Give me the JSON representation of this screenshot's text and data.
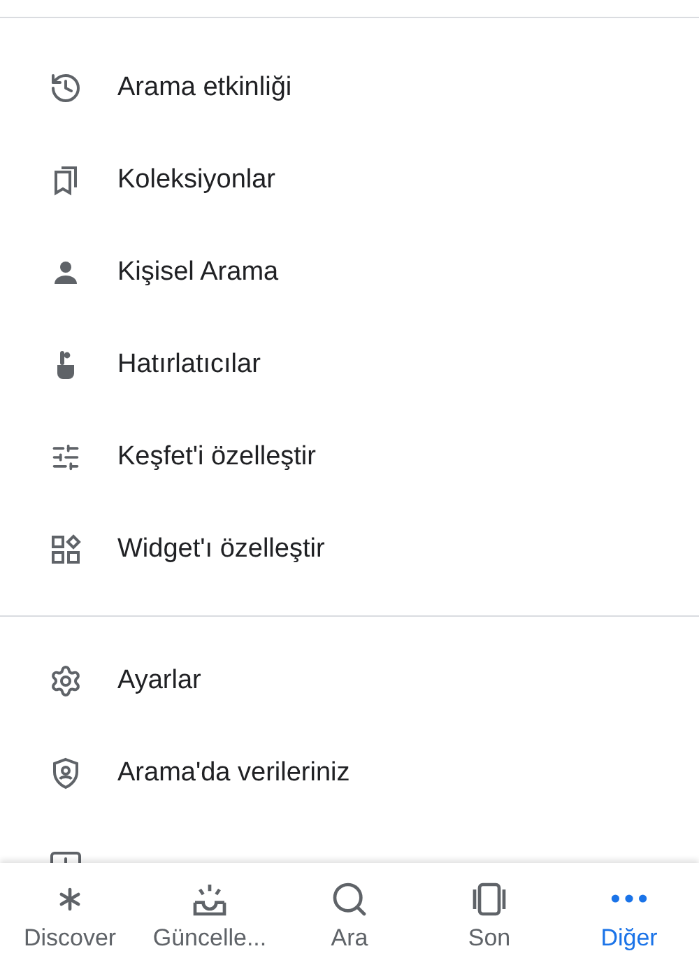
{
  "sections": [
    {
      "items": [
        {
          "kind": "history",
          "label": "Arama etkinliği"
        },
        {
          "kind": "collections",
          "label": "Koleksiyonlar"
        },
        {
          "kind": "person",
          "label": "Kişisel Arama"
        },
        {
          "kind": "reminder",
          "label": "Hatırlatıcılar"
        },
        {
          "kind": "tune",
          "label": "Keşfet'i özelleştir"
        },
        {
          "kind": "widgets",
          "label": "Widget'ı özelleştir"
        }
      ]
    },
    {
      "items": [
        {
          "kind": "settings",
          "label": "Ayarlar"
        },
        {
          "kind": "shield",
          "label": "Arama'da verileriniz"
        },
        {
          "kind": "feedback"
        }
      ]
    }
  ],
  "nav": [
    {
      "kind": "discover",
      "label": "Discover",
      "selected": false
    },
    {
      "kind": "updates",
      "label": "Güncelle...",
      "selected": false
    },
    {
      "kind": "search",
      "label": "Ara",
      "selected": false
    },
    {
      "kind": "recent",
      "label": "Son",
      "selected": false
    },
    {
      "kind": "more",
      "label": "Diğer",
      "selected": true
    }
  ]
}
